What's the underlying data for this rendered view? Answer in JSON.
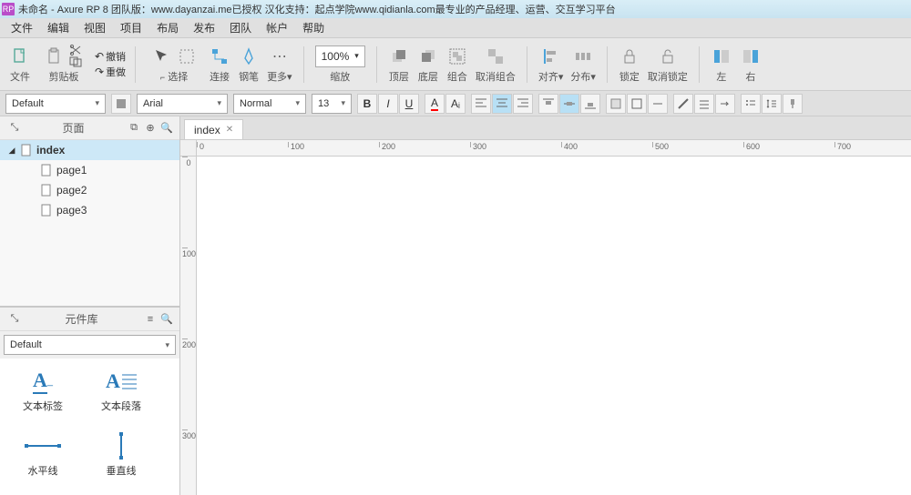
{
  "titlebar": "未命名 - Axure RP 8 团队版：www.dayanzai.me已授权 汉化支持：起点学院www.qidianla.com最专业的产品经理、运营、交互学习平台",
  "menu": [
    "文件",
    "编辑",
    "视图",
    "项目",
    "布局",
    "发布",
    "团队",
    "帐户",
    "帮助"
  ],
  "toolbar": {
    "file": "文件",
    "clipboard": "剪贴板",
    "undo": "撤销",
    "redo": "重做",
    "selector": "选择",
    "connect": "连接",
    "pen": "钢笔",
    "more": "更多▾",
    "zoom": "缩放",
    "zoom_value": "100%",
    "front": "顶层",
    "back": "底层",
    "group": "组合",
    "ungroup": "取消组合",
    "align": "对齐▾",
    "distribute": "分布▾",
    "lock": "锁定",
    "unlock": "取消锁定",
    "left": "左",
    "right": "右"
  },
  "format": {
    "style_preset": "Default",
    "font": "Arial",
    "weight": "Normal",
    "size": "13"
  },
  "pages_panel": {
    "title": "页面",
    "root": "index",
    "children": [
      "page1",
      "page2",
      "page3"
    ]
  },
  "widgets_panel": {
    "title": "元件库",
    "library": "Default",
    "items": [
      "文本标签",
      "文本段落",
      "水平线",
      "垂直线"
    ]
  },
  "tab": {
    "label": "index"
  },
  "ruler_h": [
    "0",
    "100",
    "200",
    "300",
    "400",
    "500",
    "600",
    "700"
  ],
  "ruler_v": [
    "0",
    "100",
    "200",
    "300"
  ]
}
